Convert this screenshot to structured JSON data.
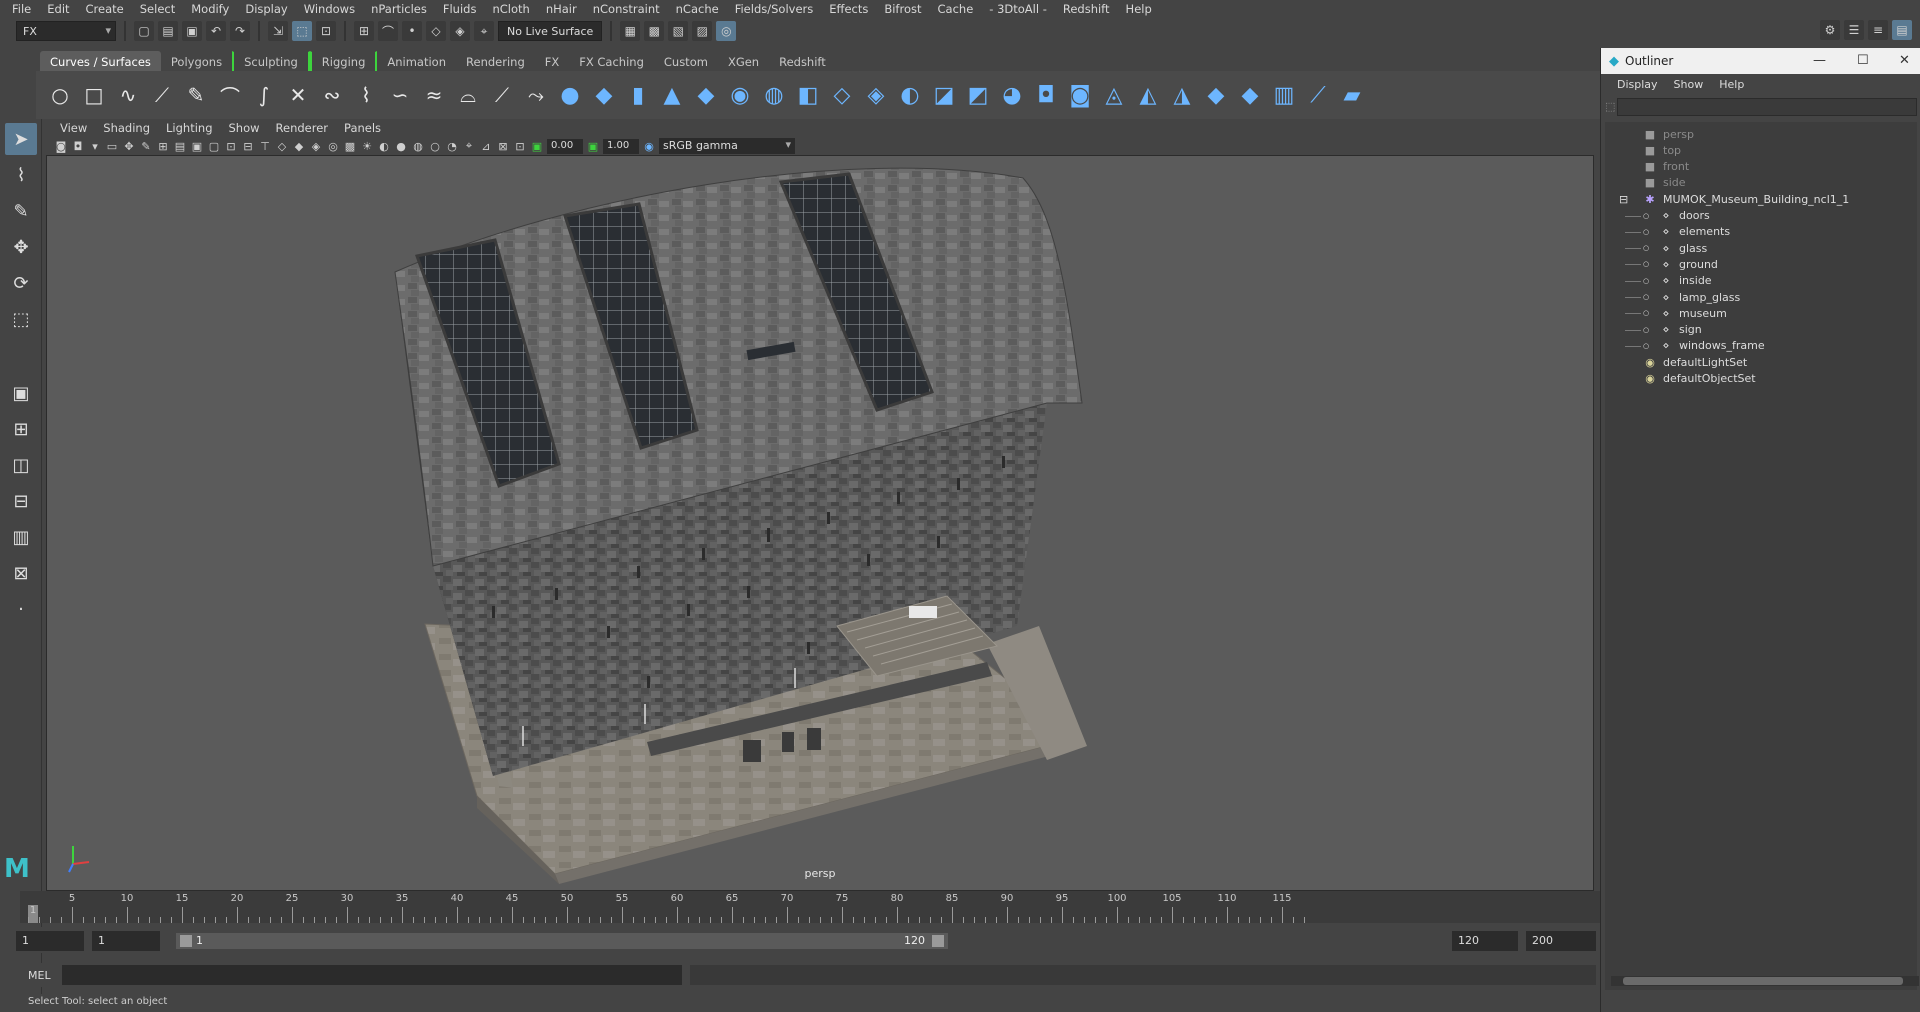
{
  "menubar": [
    "File",
    "Edit",
    "Create",
    "Select",
    "Modify",
    "Display",
    "Windows",
    "nParticles",
    "Fluids",
    "nCloth",
    "nHair",
    "nConstraint",
    "nCache",
    "Fields/Solvers",
    "Effects",
    "Bifrost",
    "Cache",
    "- 3DtoAll -",
    "Redshift",
    "Help"
  ],
  "statusline": {
    "mode": "FX",
    "live_surface": "No Live Surface"
  },
  "shelf_tabs": [
    "Curves / Surfaces",
    "Polygons",
    "Sculpting",
    "Rigging",
    "Animation",
    "Rendering",
    "FX",
    "FX Caching",
    "Custom",
    "XGen",
    "Redshift"
  ],
  "panel_menu": [
    "View",
    "Shading",
    "Lighting",
    "Show",
    "Renderer",
    "Panels"
  ],
  "panel_tools": {
    "exposure": "0.00",
    "gamma": "1.00",
    "color_space": "sRGB gamma"
  },
  "viewport": {
    "camera_label": "persp"
  },
  "timeline": {
    "ticks": [
      "5",
      "10",
      "15",
      "20",
      "25",
      "30",
      "35",
      "40",
      "45",
      "50",
      "55",
      "60",
      "65",
      "70",
      "75",
      "80",
      "85",
      "90",
      "95",
      "100",
      "105",
      "110",
      "115"
    ],
    "current_frame": "1"
  },
  "range": {
    "start": "1",
    "anim_start": "1",
    "slider_start": "1",
    "slider_end": "120",
    "end": "120",
    "anim_end": "200"
  },
  "mel": {
    "label": "MEL"
  },
  "helpline": "Select Tool: select an object",
  "outliner": {
    "title": "Outliner",
    "menu": [
      "Display",
      "Show",
      "Help"
    ],
    "rows": [
      {
        "label": "persp",
        "icon": "camera-icon",
        "dim": true,
        "indent": 0
      },
      {
        "label": "top",
        "icon": "camera-icon",
        "dim": true,
        "indent": 0
      },
      {
        "label": "front",
        "icon": "camera-icon",
        "dim": true,
        "indent": 0
      },
      {
        "label": "side",
        "icon": "camera-icon",
        "dim": true,
        "indent": 0
      },
      {
        "label": "MUMOK_Museum_Building_ncl1_1",
        "icon": "group-icon",
        "dim": false,
        "indent": 0,
        "expand": "−"
      },
      {
        "label": "doors",
        "icon": "mesh-icon",
        "dim": false,
        "indent": 1
      },
      {
        "label": "elements",
        "icon": "mesh-icon",
        "dim": false,
        "indent": 1
      },
      {
        "label": "glass",
        "icon": "mesh-icon",
        "dim": false,
        "indent": 1
      },
      {
        "label": "ground",
        "icon": "mesh-icon",
        "dim": false,
        "indent": 1
      },
      {
        "label": "inside",
        "icon": "mesh-icon",
        "dim": false,
        "indent": 1
      },
      {
        "label": "lamp_glass",
        "icon": "mesh-icon",
        "dim": false,
        "indent": 1
      },
      {
        "label": "museum",
        "icon": "mesh-icon",
        "dim": false,
        "indent": 1
      },
      {
        "label": "sign",
        "icon": "mesh-icon",
        "dim": false,
        "indent": 1
      },
      {
        "label": "windows_frame",
        "icon": "mesh-icon",
        "dim": false,
        "indent": 1
      },
      {
        "label": "defaultLightSet",
        "icon": "set-icon",
        "dim": false,
        "indent": 0
      },
      {
        "label": "defaultObjectSet",
        "icon": "set-icon",
        "dim": false,
        "indent": 0
      }
    ]
  },
  "colors": {
    "accent": "#5a7a92",
    "shelf_icon": "#6db6ff",
    "highlight_green": "#3dd43d"
  }
}
